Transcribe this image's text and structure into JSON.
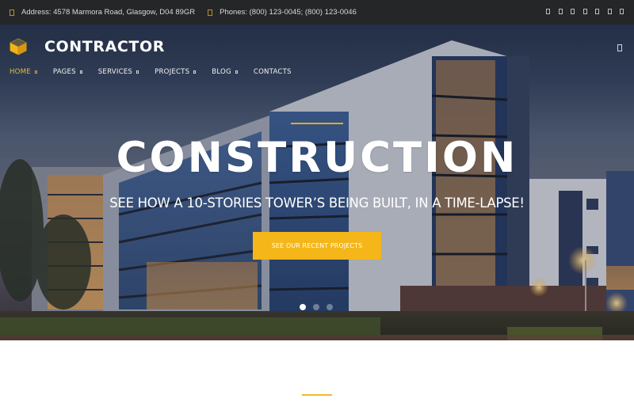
{
  "topbar": {
    "address": "Address: 4578 Marmora Road, Glasgow, D04 89GR",
    "phones": "Phones: (800) 123-0045; (800) 123-0046",
    "address_icon": "map-marker-icon",
    "phone_icon": "phone-icon",
    "social_icons": [
      "facebook-icon",
      "twitter-icon",
      "google-plus-icon",
      "instagram-icon",
      "linkedin-icon",
      "pinterest-icon",
      "rss-icon"
    ]
  },
  "header": {
    "logo_icon": "cube-icon",
    "brand": "CONTRACTOR",
    "menu_toggle_icon": "menu-icon"
  },
  "nav": {
    "items": [
      {
        "label": "HOME",
        "active": true,
        "has_dropdown": true
      },
      {
        "label": "PAGES",
        "active": false,
        "has_dropdown": true
      },
      {
        "label": "SERVICES",
        "active": false,
        "has_dropdown": true
      },
      {
        "label": "PROJECTS",
        "active": false,
        "has_dropdown": true
      },
      {
        "label": "BLOG",
        "active": false,
        "has_dropdown": true
      },
      {
        "label": "CONTACTS",
        "active": false,
        "has_dropdown": false
      }
    ]
  },
  "hero": {
    "title": "CONSTRUCTION",
    "subtitle": "SEE HOW A 10-STORIES TOWER’S BEING BUILT, IN A TIME-LAPSE!",
    "cta_label": "SEE OUR RECENT PROJECTS",
    "slides_total": 3,
    "slide_active": 1
  },
  "colors": {
    "accent": "#f5b619",
    "topbar_bg": "#252628",
    "nav_active": "#e6b93a"
  }
}
